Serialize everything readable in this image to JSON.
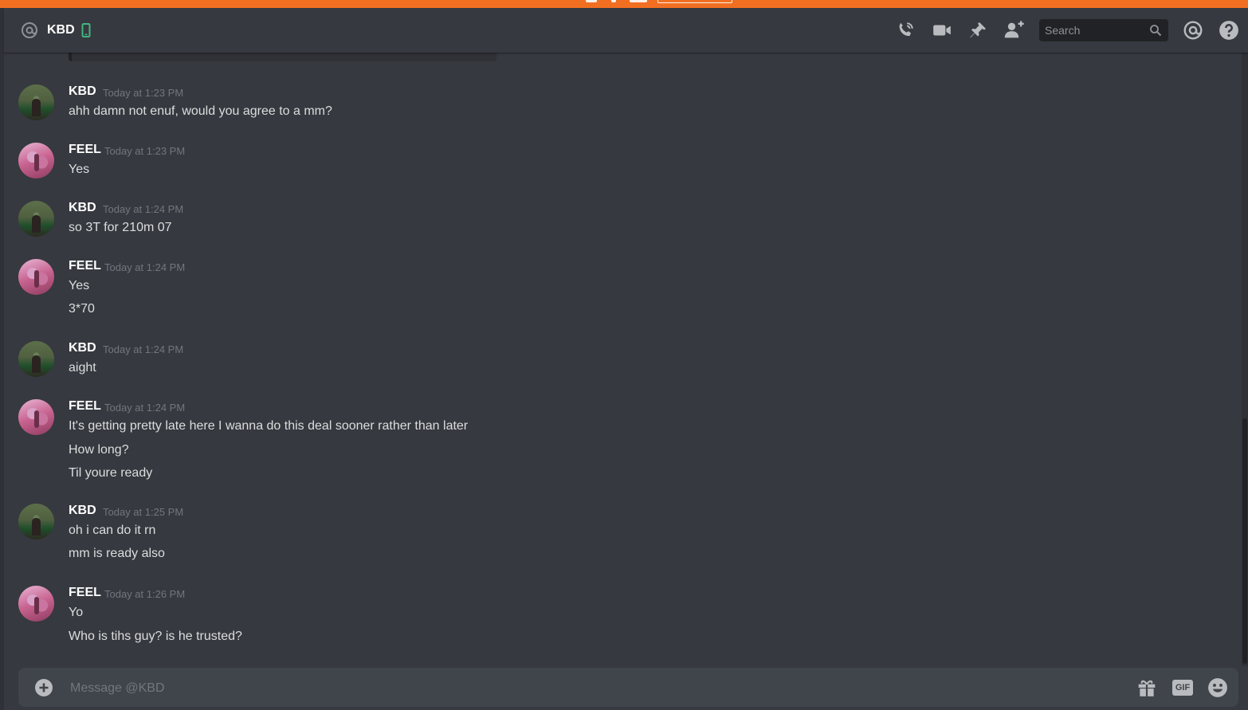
{
  "header": {
    "title": "KBD",
    "search_placeholder": "Search",
    "icons": [
      "at-icon",
      "mobile-phone-icon",
      "voice-call-icon",
      "video-call-icon",
      "pin-icon",
      "add-friend-icon",
      "search-icon",
      "mentions-icon",
      "help-icon"
    ]
  },
  "messages": [
    {
      "author": "KBD",
      "timestamp": "Today at 1:23 PM",
      "lines": [
        "ahh damn not enuf, would you agree to a mm?"
      ]
    },
    {
      "author": "FEEL",
      "timestamp": "Today at 1:23 PM",
      "lines": [
        "Yes"
      ]
    },
    {
      "author": "KBD",
      "timestamp": "Today at 1:24 PM",
      "lines": [
        "so 3T for 210m 07"
      ]
    },
    {
      "author": "FEEL",
      "timestamp": "Today at 1:24 PM",
      "lines": [
        "Yes",
        "3*70"
      ]
    },
    {
      "author": "KBD",
      "timestamp": "Today at 1:24 PM",
      "lines": [
        "aight"
      ]
    },
    {
      "author": "FEEL",
      "timestamp": "Today at 1:24 PM",
      "lines": [
        "It's getting pretty late here I wanna do this deal sooner rather than later",
        "How long?",
        "Til youre ready"
      ]
    },
    {
      "author": "KBD",
      "timestamp": "Today at 1:25 PM",
      "lines": [
        "oh i can do it rn",
        "mm is ready also"
      ]
    },
    {
      "author": "FEEL",
      "timestamp": "Today at 1:26 PM",
      "lines": [
        "Yo",
        "Who is tihs guy? is he trusted?"
      ]
    }
  ],
  "composer": {
    "placeholder": "Message @KBD",
    "gif_label": "GIF",
    "icons": [
      "add-attachment-icon",
      "gift-icon",
      "gif-icon",
      "emoji-icon"
    ]
  },
  "colors": {
    "top_strip": "#f26f22",
    "background": "#36393f",
    "online_mobile": "#43b581",
    "username": "#ffffff",
    "timestamp": "#72767d",
    "message_text": "#dcddde"
  }
}
